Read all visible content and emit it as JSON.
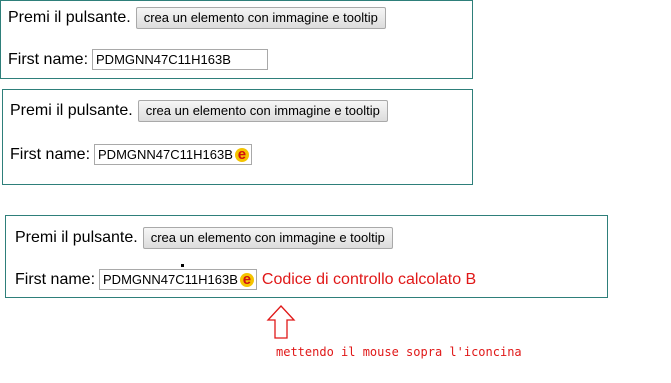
{
  "panels": [
    {
      "prompt_label": "Premi il pulsante.",
      "button_label": "crea un elemento con immagine e tooltip",
      "field_label": "First name:",
      "field_value": "PDMGNN47C11H163B"
    },
    {
      "prompt_label": "Premi il pulsante.",
      "button_label": "crea un elemento con immagine e tooltip",
      "field_label": "First name:",
      "field_value": "PDMGNN47C11H163B",
      "icon_letter": "e"
    },
    {
      "prompt_label": "Premi il pulsante.",
      "button_label": "crea un elemento con immagine e tooltip",
      "field_label": "First name:",
      "field_value": "PDMGNN47C11H163B",
      "icon_letter": "e",
      "tooltip_text": "Codice di controllo calcolato B"
    }
  ],
  "annotation": {
    "caption": "mettendo il mouse sopra l'iconcina"
  },
  "colors": {
    "panel_border": "#2e7f7a",
    "annotation_red": "#e01818",
    "icon_bg": "#f5c400",
    "icon_letter": "#d01010"
  }
}
